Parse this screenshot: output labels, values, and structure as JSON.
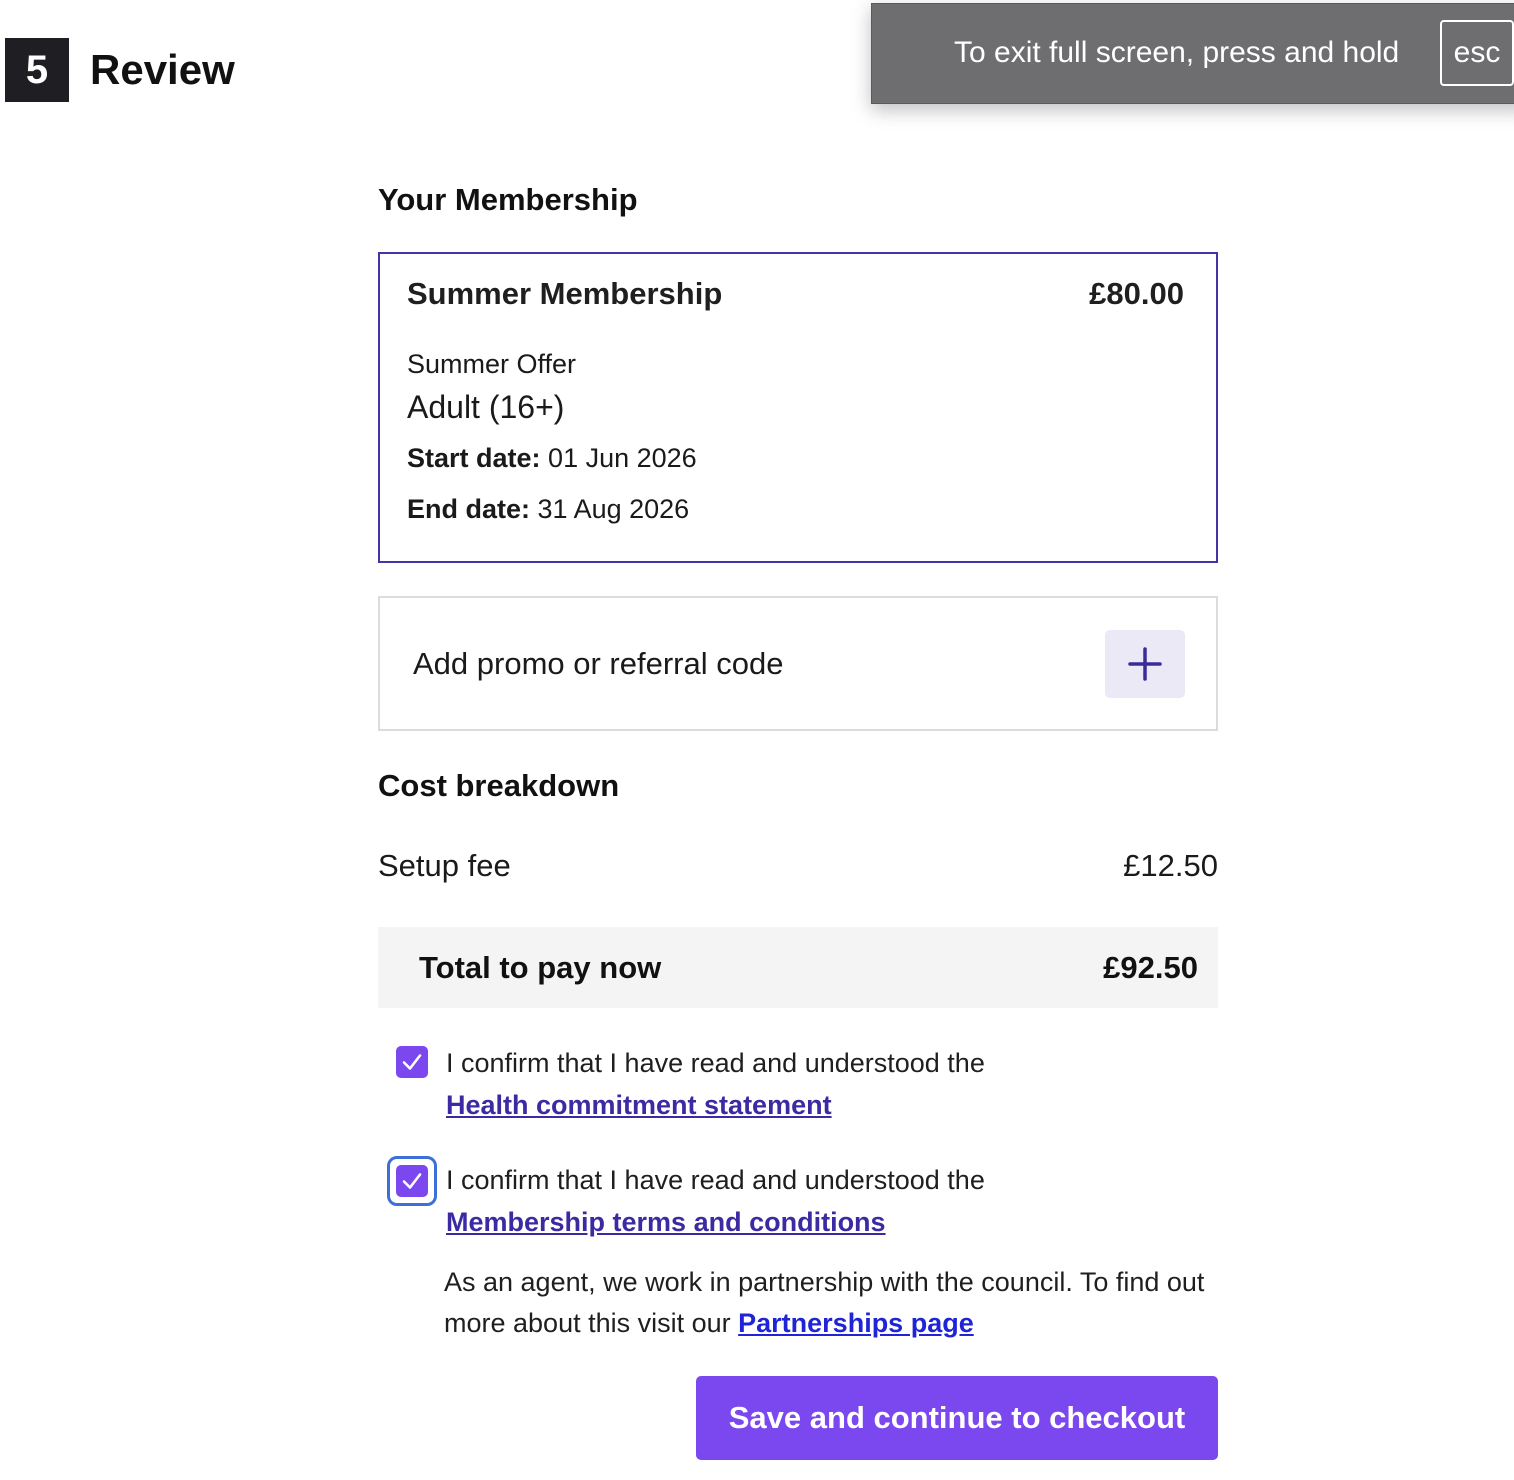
{
  "step": {
    "number": "5",
    "title": "Review"
  },
  "fullscreen_banner": {
    "message": "To exit full screen, press and hold",
    "key": "esc"
  },
  "membership": {
    "section_title": "Your Membership",
    "name": "Summer Membership",
    "price": "£80.00",
    "offer": "Summer Offer",
    "category": "Adult (16+)",
    "start_label": "Start date:",
    "start_value": "01 Jun 2026",
    "end_label": "End date:",
    "end_value": "31 Aug 2026"
  },
  "promo": {
    "label": "Add promo or referral code",
    "icon": "plus-icon"
  },
  "cost": {
    "section_title": "Cost breakdown",
    "setup_fee_label": "Setup fee",
    "setup_fee_value": "£12.50",
    "total_label": "Total to pay now",
    "total_value": "£92.50"
  },
  "confirmations": [
    {
      "checked": true,
      "text": "I confirm that I have read and understood the",
      "link": "Health commitment statement"
    },
    {
      "checked": true,
      "text": "I confirm that I have read and understood the",
      "link": "Membership terms and conditions"
    }
  ],
  "agent_note": {
    "text": "As an agent, we work in partnership with the council. To find out more about this visit our",
    "link": "Partnerships page"
  },
  "cta": {
    "label": "Save and continue to checkout"
  },
  "colors": {
    "accent": "#7b47ee",
    "card_border": "#4534a6",
    "link": "#3c2aa3",
    "focus_ring": "#3e6fd8"
  }
}
